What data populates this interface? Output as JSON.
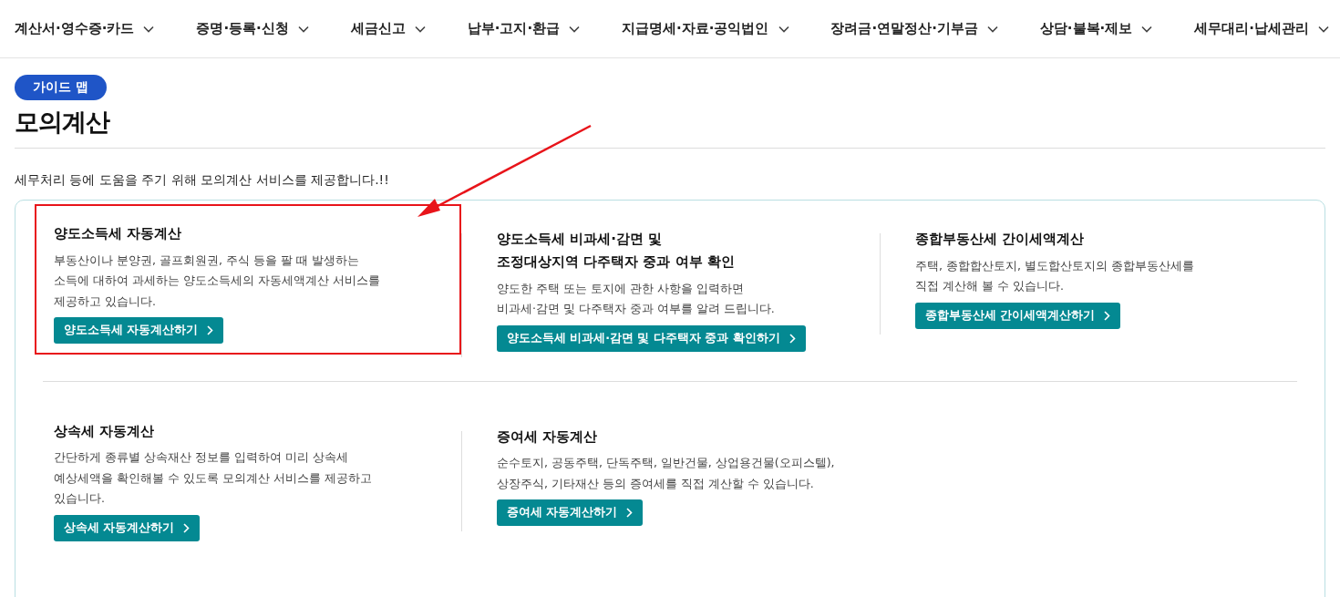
{
  "nav": [
    {
      "label": "계산서·영수증·카드"
    },
    {
      "label": "증명·등록·신청"
    },
    {
      "label": "세금신고"
    },
    {
      "label": "납부·고지·환급"
    },
    {
      "label": "지급명세·자료·공익법인"
    },
    {
      "label": "장려금·연말정산·기부금"
    },
    {
      "label": "상담·불복·제보"
    },
    {
      "label": "세무대리·납세관리"
    }
  ],
  "badge": "가이드 맵",
  "title": "모의계산",
  "intro": "세무처리 등에 도움을 주기 위해 모의계산 서비스를 제공합니다.!!",
  "services": [
    {
      "title": "양도소득세 자동계산",
      "description": "부동산이나 분양권, 골프회원권, 주식 등을 팔 때 발생하는\n소득에 대하여 과세하는 양도소득세의 자동세액계산 서비스를\n제공하고 있습니다.",
      "button": "양도소득세 자동계산하기",
      "highlighted": true
    },
    {
      "title": "양도소득세 비과세·감면 및\n조정대상지역 다주택자 중과 여부 확인",
      "description": "양도한 주택 또는 토지에 관한 사항을 입력하면\n비과세·감면 및 다주택자 중과 여부를 알려 드립니다.",
      "button": "양도소득세 비과세·감면 및 다주택자 중과 확인하기",
      "highlighted": false
    },
    {
      "title": "종합부동산세 간이세액계산",
      "description": "주택, 종합합산토지, 별도합산토지의 종합부동산세를\n직접 계산해 볼 수 있습니다.",
      "button": "종합부동산세 간이세액계산하기",
      "highlighted": false
    },
    {
      "title": "상속세 자동계산",
      "description": "간단하게 종류별 상속재산 정보를 입력하여 미리 상속세\n예상세액을 확인해볼 수 있도록 모의계산 서비스를 제공하고\n있습니다.",
      "button": "상속세 자동계산하기",
      "highlighted": false
    },
    {
      "title": "증여세 자동계산",
      "description": "순수토지, 공동주택, 단독주택, 일반건물, 상업용건물(오피스텔),\n상장주식, 기타재산 등의 증여세를 직접 계산할 수 있습니다.",
      "button": "증여세 자동계산하기",
      "highlighted": false
    }
  ]
}
